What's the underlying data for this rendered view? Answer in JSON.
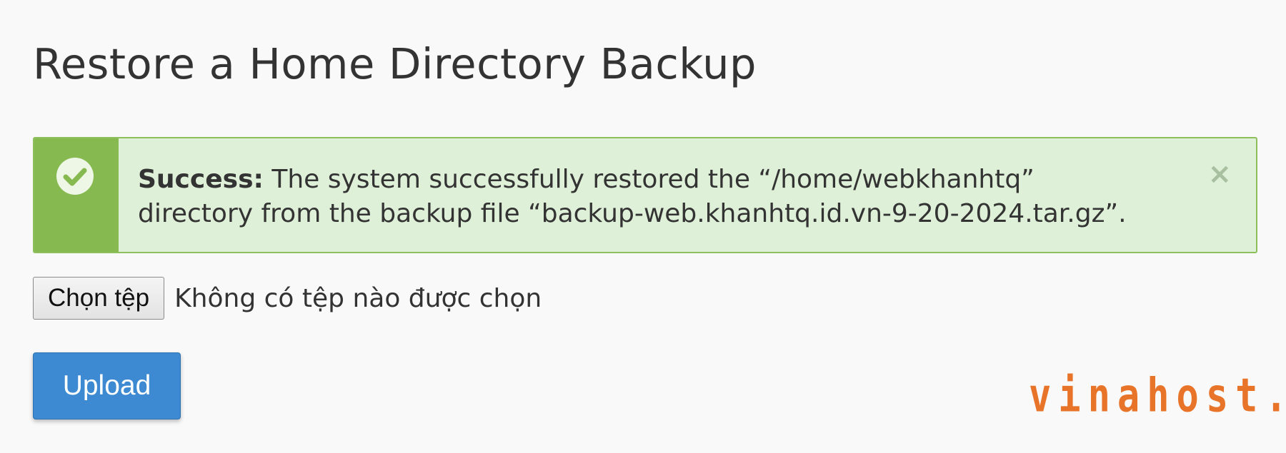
{
  "page": {
    "title": "Restore a Home Directory Backup"
  },
  "alert": {
    "type": "success",
    "label": "Success:",
    "message": " The system successfully restored the “/home/webkhanhtq” directory from the backup file “backup-web.khanhtq.id.vn-9-20-2024.tar.gz”.",
    "close_symbol": "×",
    "icon": "check-circle-icon",
    "colors": {
      "sidebar": "#86b94f",
      "background": "#dff0d8",
      "border": "#8ebf5d"
    }
  },
  "file_input": {
    "button_label": "Chọn tệp",
    "status": "Không có tệp nào được chọn"
  },
  "upload": {
    "label": "Upload",
    "color": "#3d8ad2"
  },
  "watermark": {
    "text": "vinahost.",
    "color": "#e8742a",
    "check_color": "#e0262b"
  }
}
